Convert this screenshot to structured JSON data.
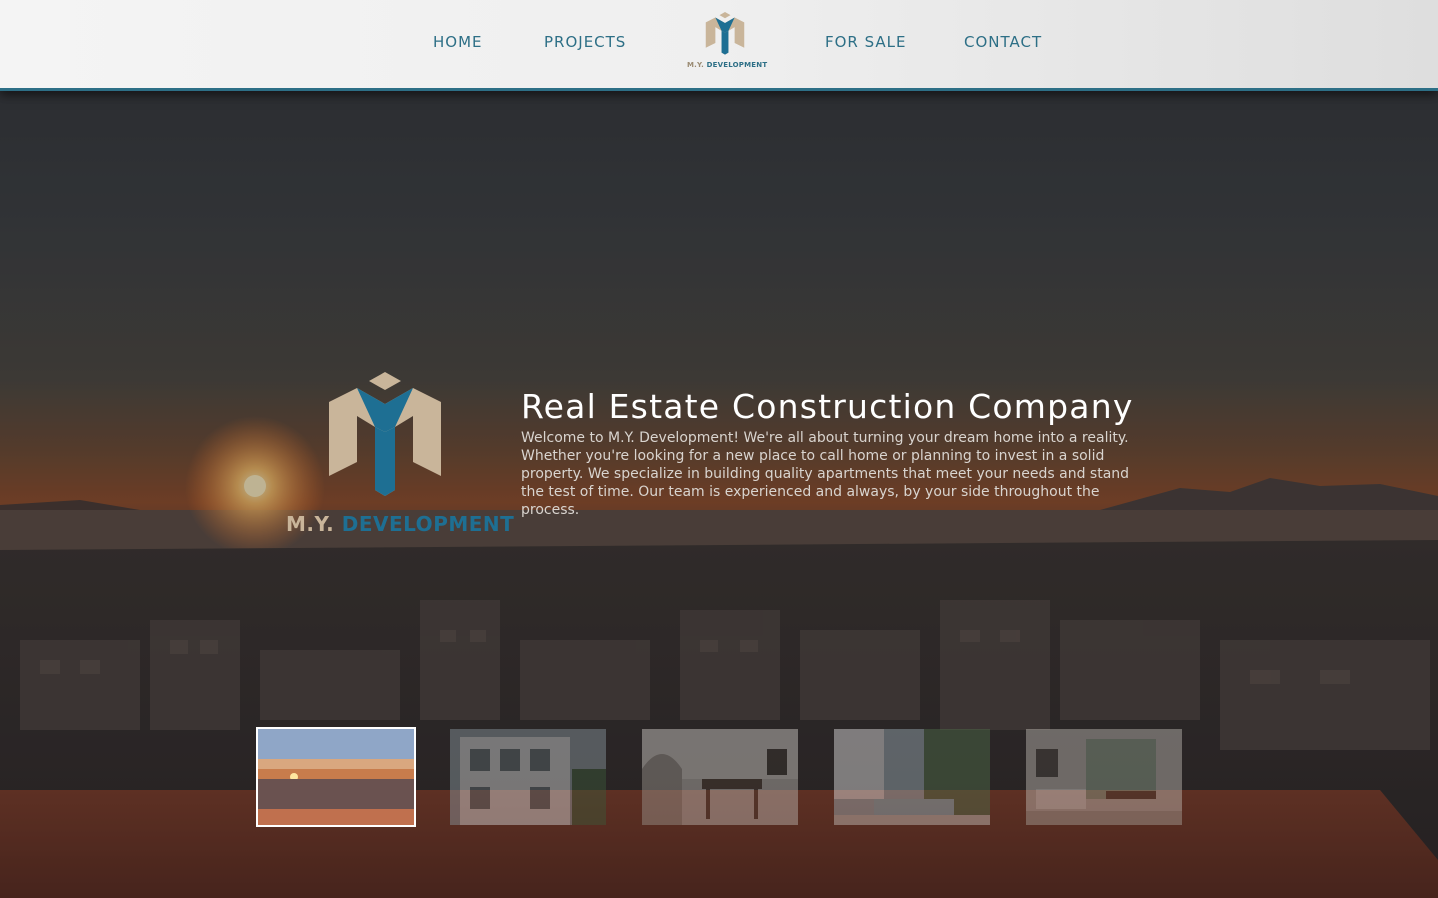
{
  "nav": {
    "home": "HOME",
    "projects": "PROJECTS",
    "for_sale": "FOR SALE",
    "contact": "CONTACT",
    "logo_prefix": "M.Y.",
    "logo_name": "DEVELOPMENT"
  },
  "hero": {
    "logo_prefix": "M.Y.",
    "logo_name": "DEVELOPMENT",
    "title": "Real Estate Construction Company",
    "text": "Welcome to M.Y. Development! We're all about turning your dream home into a reality. Whether you're looking for a new place to call home or planning to invest in a solid property. We specialize in building quality apartments that meet your needs and stand the test of time. Our team is experienced and always, by your side throughout the process."
  },
  "gallery": {
    "active_index": 0,
    "count": 5
  },
  "colors": {
    "brand_teal": "#2d6f86",
    "brand_tan": "#c9b59a",
    "brand_blue": "#1e6f93"
  },
  "icons": [
    "logo-cube-icon"
  ]
}
